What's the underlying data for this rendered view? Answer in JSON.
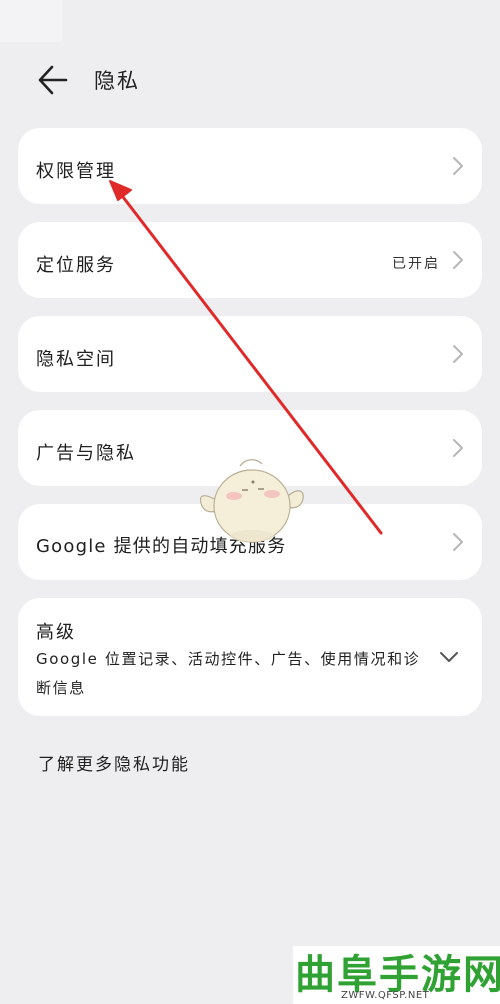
{
  "header": {
    "title": "隐私"
  },
  "items": [
    {
      "label": "权限管理"
    },
    {
      "label": "定位服务",
      "value": "已开启"
    },
    {
      "label": "隐私空间"
    },
    {
      "label": "广告与隐私"
    },
    {
      "label": "Google 提供的自动填充服务"
    }
  ],
  "advanced": {
    "title": "高级",
    "description": "Google 位置记录、活动控件、广告、使用情况和诊断信息"
  },
  "learn_more": "了解更多隐私功能",
  "watermark": {
    "name": "曲阜手游网",
    "url": "ZWFW.QFSP.NET"
  },
  "colors": {
    "arrow": "#e02a2a",
    "watermark_green": "#2fa233",
    "background": "#eeeef1",
    "card": "#ffffff"
  }
}
